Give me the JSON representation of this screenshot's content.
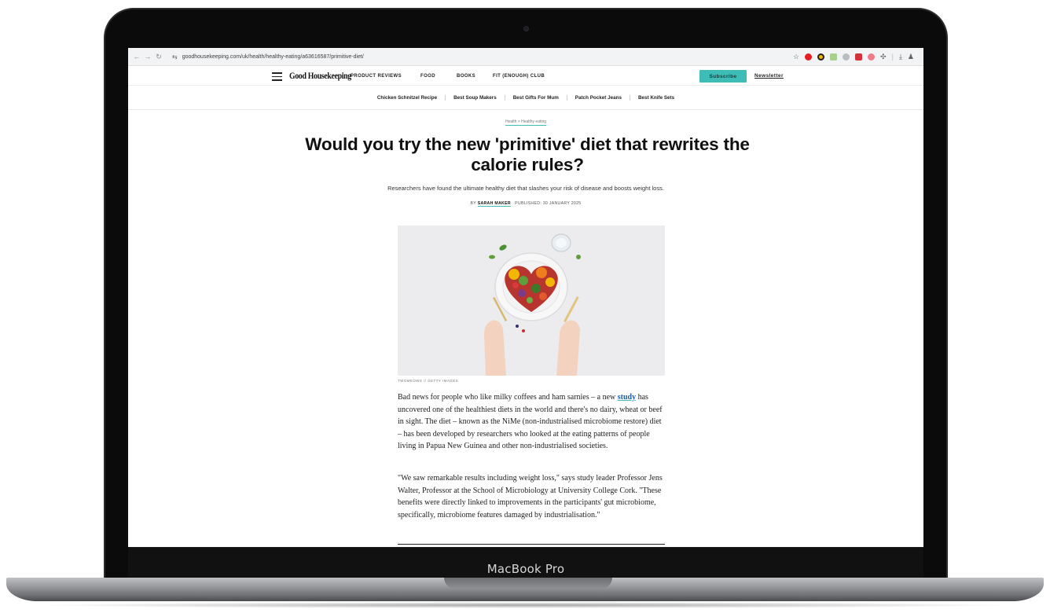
{
  "device": {
    "label": "MacBook Pro"
  },
  "browser": {
    "url": "goodhousekeeping.com/uk/health/healthy-eating/a63616587/primitive-diet/",
    "back_icon": "arrow-left-icon",
    "forward_icon": "arrow-right-icon",
    "reload_icon": "reload-icon",
    "extensions": [
      "opera-icon",
      "extension-icon",
      "extension-icon",
      "extension-icon",
      "extension-icon",
      "extension-icon",
      "puzzle-icon",
      "download-icon",
      "profile-icon"
    ]
  },
  "site": {
    "logo": "Good Housekeeping",
    "nav": [
      "PRODUCT REVIEWS",
      "FOOD",
      "BOOKS",
      "FIT (ENOUGH) CLUB"
    ],
    "subscribe": "Subscribe",
    "newsletter": "Newsletter",
    "accent_color": "#3dbdb6"
  },
  "trending": [
    "Chicken Schnitzel Recipe",
    "Best Soup Makers",
    "Best Gifts For Mum",
    "Patch Pocket Jeans",
    "Best Knife Sets"
  ],
  "article": {
    "breadcrumb": "Health > Healthy eating",
    "headline_line1": "Would you try the new 'primitive' diet that rewrites the",
    "headline_line2": "calorie rules?",
    "dek": "Researchers have found the ultimate healthy diet that slashes your risk of disease and boosts weight loss.",
    "byline_prefix": "BY",
    "author": "SARAH MAKER",
    "published": "PUBLISHED: 30 JANUARY 2025",
    "image_credit": "TWOMEOWS // GETTY IMAGES",
    "p1_before": "Bad news for people who like milky coffees and ham sarnies – a new ",
    "p1_link": "study",
    "p1_after": " has uncovered one of the healthiest diets in the world and there's no dairy, wheat or beef in sight. The diet – known as the NiMe (non-industrialised microbiome restore) diet – has been developed by researchers who looked at the eating patterns of people living in Papua New Guinea and other non-industrialised societies.",
    "p2": "\"We saw remarkable results including weight loss,\" says study leader Professor Jens Walter, Professor at the School of Microbiology at University College Cork. \"These benefits were directly linked to improvements in the participants' gut microbiome, specifically, microbiome features damaged by industrialisation.\""
  }
}
